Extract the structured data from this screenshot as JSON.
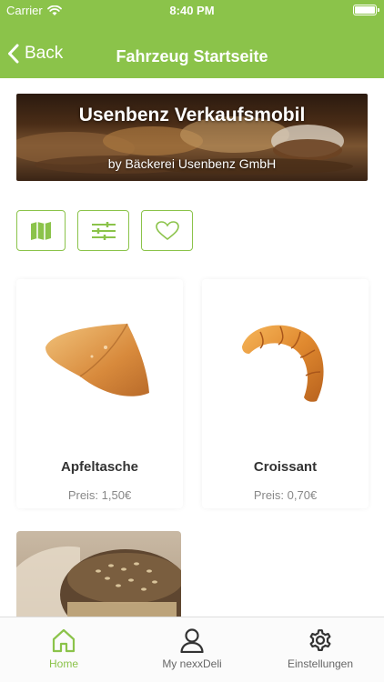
{
  "status_bar": {
    "carrier": "Carrier",
    "time": "8:40 PM"
  },
  "nav": {
    "back_label": "Back",
    "title": "Fahrzeug Startseite"
  },
  "banner": {
    "title": "Usenbenz Verkaufsmobil",
    "subtitle": "by Bäckerei Usenbenz GmbH"
  },
  "actions": [
    {
      "icon": "map-icon"
    },
    {
      "icon": "filter-sliders-icon"
    },
    {
      "icon": "heart-icon"
    }
  ],
  "products": [
    {
      "name": "Apfeltasche",
      "price": "Preis: 1,50€"
    },
    {
      "name": "Croissant",
      "price": "Preis: 0,70€"
    }
  ],
  "tabs": [
    {
      "label": "Home",
      "icon": "home-icon",
      "active": true
    },
    {
      "label": "My nexxDeli",
      "icon": "user-icon",
      "active": false
    },
    {
      "label": "Einstellungen",
      "icon": "gear-icon",
      "active": false
    }
  ],
  "colors": {
    "accent": "#8bc34a",
    "text": "#333333",
    "muted": "#888888"
  }
}
